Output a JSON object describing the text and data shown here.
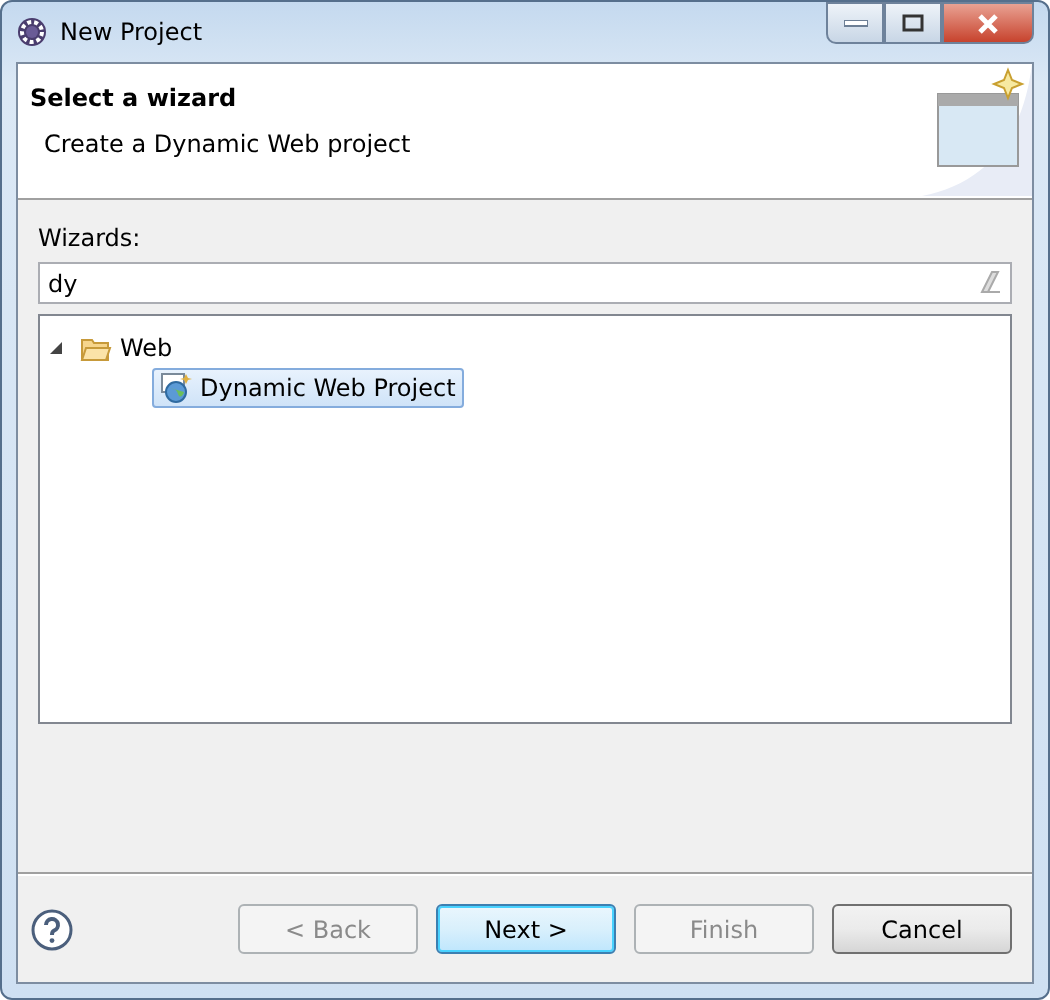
{
  "window": {
    "title": "New Project"
  },
  "header": {
    "title": "Select a wizard",
    "description": "Create a Dynamic Web project"
  },
  "wizards": {
    "label": "Wizards:",
    "filter": {
      "value": "dy"
    },
    "tree": [
      {
        "label": "Web",
        "kind": "folder",
        "expanded": true,
        "selected": false,
        "children": [
          {
            "label": "Dynamic Web Project",
            "kind": "project",
            "selected": true
          }
        ]
      }
    ]
  },
  "buttons": [
    {
      "label": "< Back",
      "disabled": true,
      "default": false
    },
    {
      "label": "Next >",
      "disabled": false,
      "default": true
    },
    {
      "label": "Finish",
      "disabled": true,
      "default": false
    },
    {
      "label": "Cancel",
      "disabled": false,
      "default": false
    }
  ]
}
